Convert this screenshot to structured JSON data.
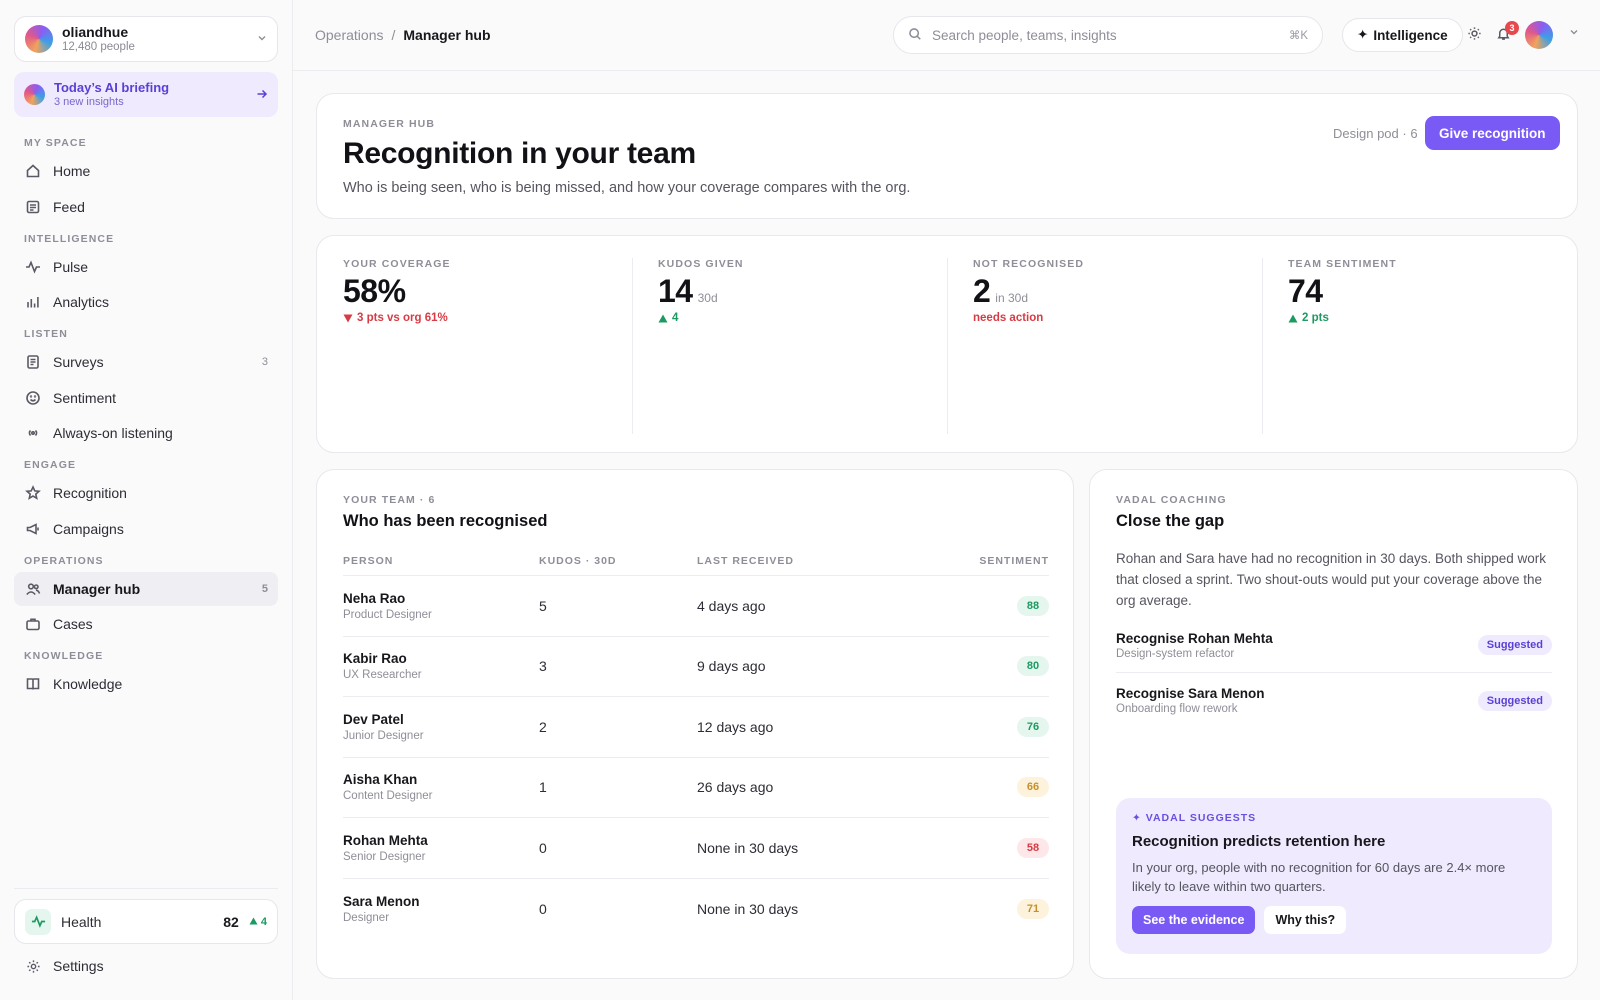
{
  "org": {
    "name": "oliandhue",
    "subtitle": "12,480 people"
  },
  "briefing": {
    "title": "Today’s AI briefing",
    "subtitle": "3 new insights"
  },
  "nav": {
    "sections": [
      {
        "label": "MY SPACE",
        "items": [
          {
            "label": "Home",
            "icon": "home-icon"
          },
          {
            "label": "Feed",
            "icon": "feed-icon"
          }
        ]
      },
      {
        "label": "INTELLIGENCE",
        "items": [
          {
            "label": "Pulse",
            "icon": "pulse-icon"
          },
          {
            "label": "Analytics",
            "icon": "bar-chart-icon"
          }
        ]
      },
      {
        "label": "LISTEN",
        "items": [
          {
            "label": "Surveys",
            "icon": "document-icon",
            "count": "3"
          },
          {
            "label": "Sentiment",
            "icon": "smile-icon"
          },
          {
            "label": "Always-on listening",
            "icon": "broadcast-icon"
          }
        ]
      },
      {
        "label": "ENGAGE",
        "items": [
          {
            "label": "Recognition",
            "icon": "star-icon"
          },
          {
            "label": "Campaigns",
            "icon": "megaphone-icon"
          }
        ]
      },
      {
        "label": "OPERATIONS",
        "items": [
          {
            "label": "Manager hub",
            "icon": "users-icon",
            "count": "5",
            "active": true
          },
          {
            "label": "Cases",
            "icon": "briefcase-icon"
          }
        ]
      },
      {
        "label": "KNOWLEDGE",
        "items": [
          {
            "label": "Knowledge",
            "icon": "book-icon"
          }
        ]
      }
    ]
  },
  "health": {
    "label": "Health",
    "value": "82",
    "delta": "4"
  },
  "settings": {
    "label": "Settings"
  },
  "topbar": {
    "breadcrumb_parent": "Operations",
    "breadcrumb_sep": "/",
    "breadcrumb_current": "Manager hub",
    "search_placeholder": "Search people, teams, insights",
    "search_shortcut": "⌘K",
    "intelligence_label": "Intelligence",
    "notification_count": "3"
  },
  "header": {
    "eyebrow": "MANAGER HUB",
    "title": "Recognition in your team",
    "subtitle": "Who is being seen, who is being missed, and how your coverage compares with the org.",
    "pod_label": "Design pod · 6",
    "give_label": "Give recognition"
  },
  "stats": [
    {
      "label": "YOUR COVERAGE",
      "value": "58%",
      "unit": "",
      "delta": "3 pts vs org 61%",
      "direction": "down"
    },
    {
      "label": "KUDOS GIVEN",
      "value": "14",
      "unit": "30d",
      "delta": "4",
      "direction": "up"
    },
    {
      "label": "NOT RECOGNISED",
      "value": "2",
      "unit": "in 30d",
      "delta": "needs action",
      "direction": "none"
    },
    {
      "label": "TEAM SENTIMENT",
      "value": "74",
      "unit": "",
      "delta": "2 pts",
      "direction": "up"
    }
  ],
  "team": {
    "eyebrow": "YOUR TEAM · 6",
    "title": "Who has been recognised",
    "columns": [
      "PERSON",
      "KUDOS · 30D",
      "LAST RECEIVED",
      "SENTIMENT"
    ],
    "rows": [
      {
        "name": "Neha Rao",
        "role": "Product Designer",
        "kudos": "5",
        "last": "4 days ago",
        "sentiment": "88",
        "tone": "good"
      },
      {
        "name": "Kabir Rao",
        "role": "UX Researcher",
        "kudos": "3",
        "last": "9 days ago",
        "sentiment": "80",
        "tone": "good"
      },
      {
        "name": "Dev Patel",
        "role": "Junior Designer",
        "kudos": "2",
        "last": "12 days ago",
        "sentiment": "76",
        "tone": "good"
      },
      {
        "name": "Aisha Khan",
        "role": "Content Designer",
        "kudos": "1",
        "last": "26 days ago",
        "sentiment": "66",
        "tone": "warn"
      },
      {
        "name": "Rohan Mehta",
        "role": "Senior Designer",
        "kudos": "0",
        "last": "None in 30 days",
        "sentiment": "58",
        "tone": "bad"
      },
      {
        "name": "Sara Menon",
        "role": "Designer",
        "kudos": "0",
        "last": "None in 30 days",
        "sentiment": "71",
        "tone": "warn"
      }
    ]
  },
  "coaching": {
    "eyebrow": "VADAL COACHING",
    "title": "Close the gap",
    "body": "Rohan and Sara have had no recognition in 30 days. Both shipped work that closed a sprint. Two shout-outs would put your coverage above the org average.",
    "suggestions": [
      {
        "title": "Recognise Rohan Mehta",
        "subtitle": "Design-system refactor",
        "pill": "Suggested"
      },
      {
        "title": "Recognise Sara Menon",
        "subtitle": "Onboarding flow rework",
        "pill": "Suggested"
      }
    ],
    "vadal": {
      "eyebrow": "✦ VADAL SUGGESTS",
      "title": "Recognition predicts retention here",
      "body": "In your org, people with no recognition for 60 days are 2.4× more likely to leave within two quarters.",
      "primary": "See the evidence",
      "secondary": "Why this?"
    }
  },
  "colors": {
    "accent": "#7a5af5",
    "good_bg": "#e5f6ee",
    "good_fg": "#1c9a62",
    "warn_bg": "#fdf3dc",
    "warn_fg": "#c7902a",
    "bad_bg": "#fde7e8",
    "bad_fg": "#d63c45"
  }
}
